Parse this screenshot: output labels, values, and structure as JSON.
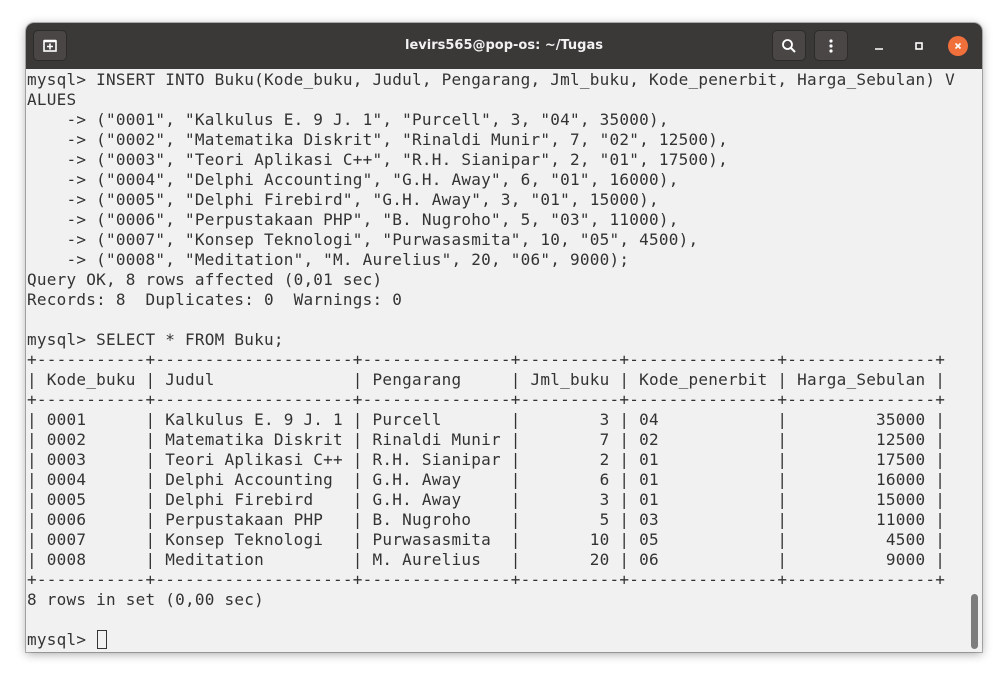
{
  "window": {
    "title": "levirs565@pop-os: ~/Tugas",
    "icons": {
      "new_tab": "new-tab-icon",
      "search": "search-icon",
      "menu": "kebab-menu-icon",
      "minimize": "minimize-icon",
      "maximize": "maximize-icon",
      "close": "close-icon"
    },
    "accent_close": "#f0703c"
  },
  "terminal": {
    "lines": [
      "mysql> INSERT INTO Buku(Kode_buku, Judul, Pengarang, Jml_buku, Kode_penerbit, Harga_Sebulan) V",
      "ALUES",
      "    -> (\"0001\", \"Kalkulus E. 9 J. 1\", \"Purcell\", 3, \"04\", 35000),",
      "    -> (\"0002\", \"Matematika Diskrit\", \"Rinaldi Munir\", 7, \"02\", 12500),",
      "    -> (\"0003\", \"Teori Aplikasi C++\", \"R.H. Sianipar\", 2, \"01\", 17500),",
      "    -> (\"0004\", \"Delphi Accounting\", \"G.H. Away\", 6, \"01\", 16000),",
      "    -> (\"0005\", \"Delphi Firebird\", \"G.H. Away\", 3, \"01\", 15000),",
      "    -> (\"0006\", \"Perpustakaan PHP\", \"B. Nugroho\", 5, \"03\", 11000),",
      "    -> (\"0007\", \"Konsep Teknologi\", \"Purwasasmita\", 10, \"05\", 4500),",
      "    -> (\"0008\", \"Meditation\", \"M. Aurelius\", 20, \"06\", 9000);",
      "Query OK, 8 rows affected (0,01 sec)",
      "Records: 8  Duplicates: 0  Warnings: 0",
      "",
      "mysql> SELECT * FROM Buku;",
      "+-----------+--------------------+---------------+----------+---------------+---------------+",
      "| Kode_buku | Judul              | Pengarang     | Jml_buku | Kode_penerbit | Harga_Sebulan |",
      "+-----------+--------------------+---------------+----------+---------------+---------------+",
      "| 0001      | Kalkulus E. 9 J. 1 | Purcell       |        3 | 04            |         35000 |",
      "| 0002      | Matematika Diskrit | Rinaldi Munir |        7 | 02            |         12500 |",
      "| 0003      | Teori Aplikasi C++ | R.H. Sianipar |        2 | 01            |         17500 |",
      "| 0004      | Delphi Accounting  | G.H. Away     |        6 | 01            |         16000 |",
      "| 0005      | Delphi Firebird    | G.H. Away     |        3 | 01            |         15000 |",
      "| 0006      | Perpustakaan PHP   | B. Nugroho    |        5 | 03            |         11000 |",
      "| 0007      | Konsep Teknologi   | Purwasasmita  |       10 | 05            |          4500 |",
      "| 0008      | Meditation         | M. Aurelius   |       20 | 06            |          9000 |",
      "+-----------+--------------------+---------------+----------+---------------+---------------+",
      "8 rows in set (0,00 sec)",
      ""
    ],
    "prompt": "mysql> "
  }
}
